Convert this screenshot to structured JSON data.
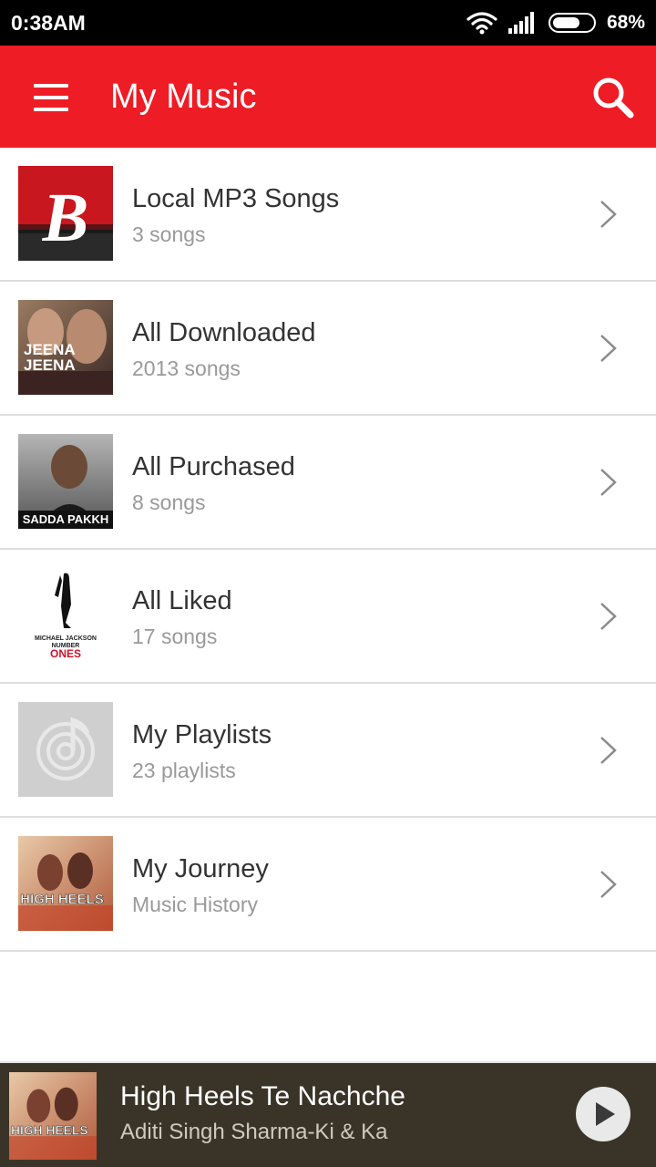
{
  "status_bar": {
    "time": "0:38AM",
    "battery": "68%",
    "battery_level": 0.68
  },
  "toolbar": {
    "title": "My Music"
  },
  "items": [
    {
      "title": "Local MP3 Songs",
      "subtitle": "3 songs",
      "art_text": "B"
    },
    {
      "title": "All Downloaded",
      "subtitle": "2013 songs",
      "art_text": "JEENA JEENA"
    },
    {
      "title": "All Purchased",
      "subtitle": "8 songs",
      "art_text": "SADDA PAKKH"
    },
    {
      "title": "All Liked",
      "subtitle": "17 songs",
      "art_text": "ONES"
    },
    {
      "title": "My Playlists",
      "subtitle": "23 playlists",
      "art_text": ""
    },
    {
      "title": "My Journey",
      "subtitle": "Music History",
      "art_text": "HIGH HEELS"
    }
  ],
  "now_playing": {
    "title": "High Heels Te Nachche",
    "artist": "Aditi Singh Sharma-Ki & Ka",
    "art_text": "HIGH HEELS"
  },
  "colors": {
    "accent": "#ee1c25",
    "player_bg": "#3a3428"
  }
}
